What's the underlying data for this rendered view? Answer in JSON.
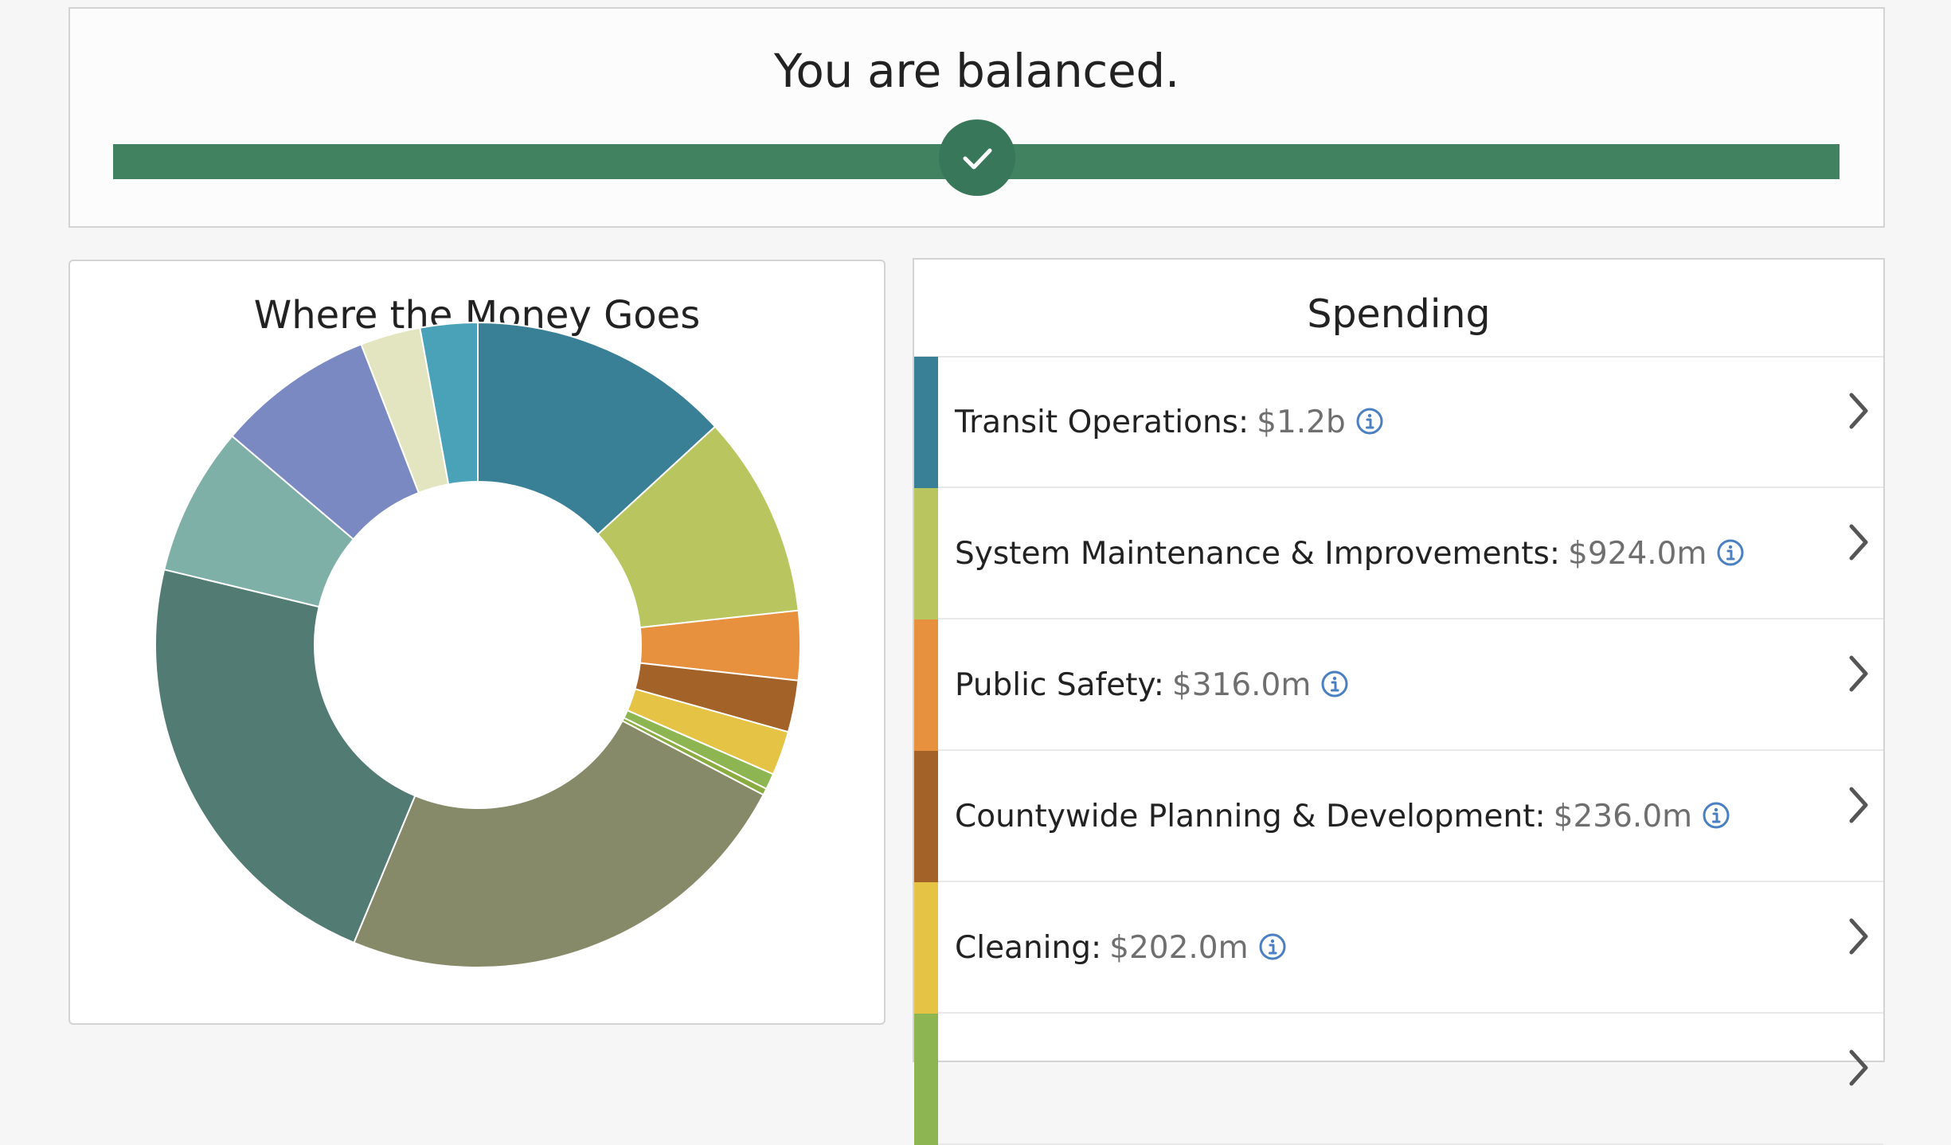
{
  "balance": {
    "title": "You are balanced.",
    "status_icon": "check-icon",
    "bar_color": "#418260",
    "position": 0.5
  },
  "chart": {
    "title": "Where the Money Goes"
  },
  "chart_data": {
    "type": "pie",
    "title": "Where the Money Goes",
    "donut": true,
    "series": [
      {
        "name": "Transit Operations",
        "value": 1200,
        "color": "#397f95"
      },
      {
        "name": "System Maintenance & Improvements",
        "value": 924,
        "color": "#b9c660"
      },
      {
        "name": "Public Safety",
        "value": 316,
        "color": "#e7913e"
      },
      {
        "name": "Countywide Planning & Development",
        "value": 236,
        "color": "#a26228"
      },
      {
        "name": "Cleaning",
        "value": 202,
        "color": "#e5c345"
      },
      {
        "name": "",
        "value": 73,
        "color": "#8db653"
      },
      {
        "name": "",
        "value": 30,
        "color": "#8aac40"
      },
      {
        "name": "",
        "value": 2150,
        "color": "#878a69"
      },
      {
        "name": "",
        "value": 2050,
        "color": "#527b73"
      },
      {
        "name": "",
        "value": 680,
        "color": "#7fb0a7"
      },
      {
        "name": "",
        "value": 720,
        "color": "#7a89c2"
      },
      {
        "name": "",
        "value": 275,
        "color": "#e2e5c0"
      },
      {
        "name": "",
        "value": 262,
        "color": "#49a2b7"
      }
    ]
  },
  "spending": {
    "title": "Spending",
    "accent_color": "#4a7fc1",
    "items": [
      {
        "label": "Transit Operations:",
        "amount": "$1.2b",
        "color": "#397f95"
      },
      {
        "label": "System Maintenance & Improvements:",
        "amount": "$924.0m",
        "color": "#b9c660"
      },
      {
        "label": "Public Safety:",
        "amount": "$316.0m",
        "color": "#e7913e"
      },
      {
        "label": "Countywide Planning & Development:",
        "amount": "$236.0m",
        "color": "#a26228"
      },
      {
        "label": "Cleaning:",
        "amount": "$202.0m",
        "color": "#e5c345"
      },
      {
        "label": "",
        "amount": "",
        "color": "#8db653"
      }
    ]
  }
}
